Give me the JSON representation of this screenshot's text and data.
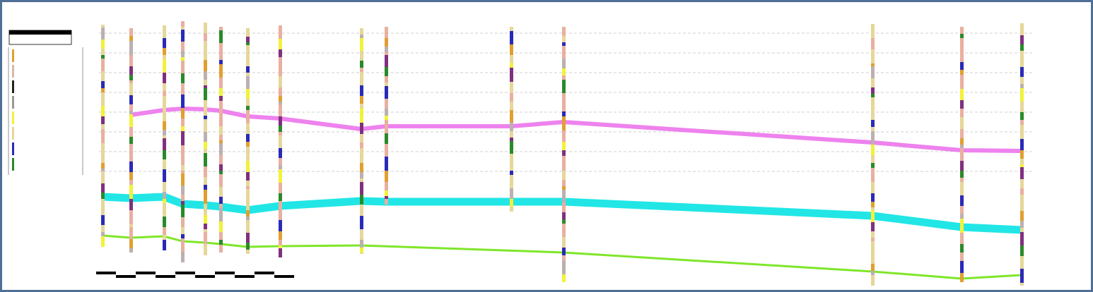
{
  "legend": {
    "swatches": [
      {
        "color": "#e0a030"
      },
      {
        "color": "#d8b8a8"
      },
      {
        "color": "#222222"
      },
      {
        "color": "#999999"
      },
      {
        "color": "#f2f23a"
      },
      {
        "color": "#e6d79a"
      },
      {
        "color": "#2a2ab8"
      },
      {
        "color": "#2a8a2a"
      }
    ]
  },
  "horizons": [
    {
      "color": "#ee82ee"
    },
    {
      "color": "#22e6e6"
    },
    {
      "color": "#7fe62a"
    }
  ]
}
